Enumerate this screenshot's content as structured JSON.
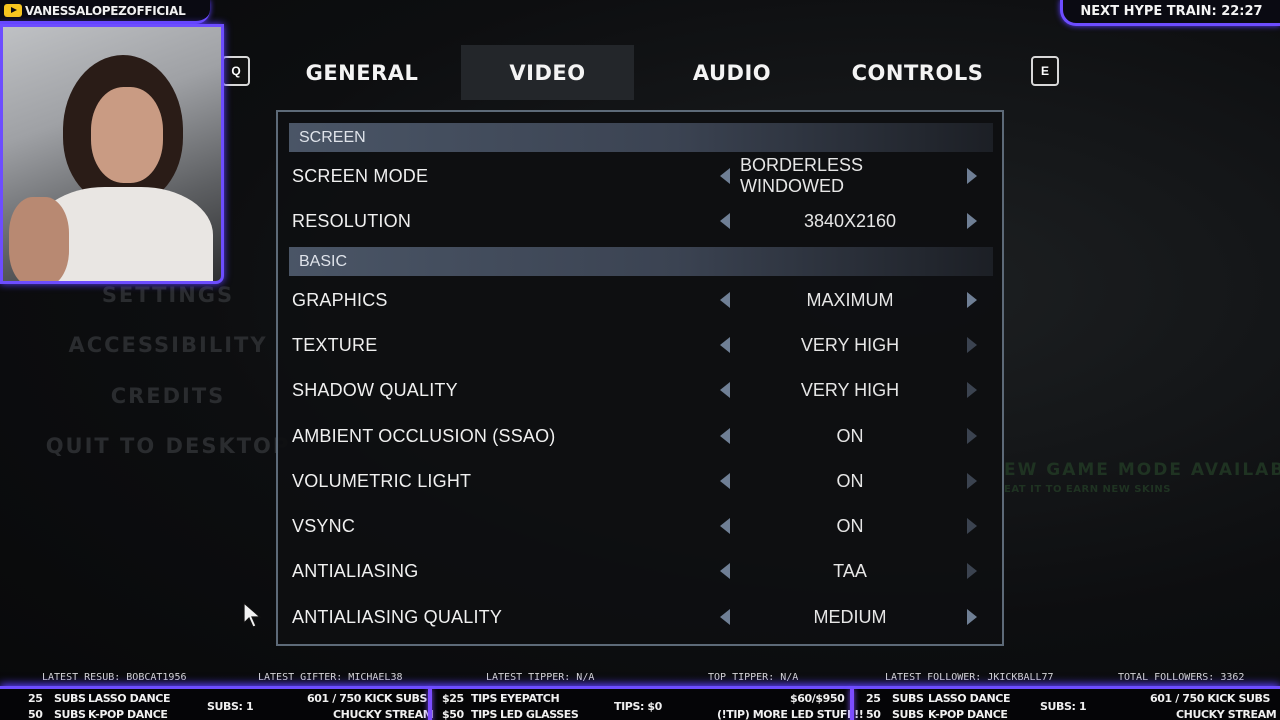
{
  "background": {
    "ghost_menu": [
      "SETTINGS",
      "ACCESSIBILITY",
      "CREDITS",
      "QUIT TO DESKTOP"
    ],
    "banner_title": "EW GAME MODE AVAILABLE!",
    "banner_sub": "EAT IT TO EARN NEW SKINS"
  },
  "tabs": {
    "prev_key": "Q",
    "next_key": "E",
    "items": [
      {
        "label": "GENERAL"
      },
      {
        "label": "VIDEO",
        "active": true
      },
      {
        "label": "AUDIO"
      },
      {
        "label": "CONTROLS"
      }
    ]
  },
  "settings": {
    "section_screen": "SCREEN",
    "section_basic": "BASIC",
    "rows": [
      {
        "label": "SCREEN MODE",
        "value": "BORDERLESS WINDOWED"
      },
      {
        "label": "RESOLUTION",
        "value": "3840X2160"
      },
      {
        "label": "GRAPHICS",
        "value": "MAXIMUM"
      },
      {
        "label": "TEXTURE",
        "value": "VERY HIGH"
      },
      {
        "label": "SHADOW QUALITY",
        "value": "VERY HIGH"
      },
      {
        "label": "AMBIENT OCCLUSION (SSAO)",
        "value": "ON"
      },
      {
        "label": "VOLUMETRIC LIGHT",
        "value": "ON"
      },
      {
        "label": "VSYNC",
        "value": "ON"
      },
      {
        "label": "ANTIALIASING",
        "value": "TAA"
      },
      {
        "label": "ANTIALIASING QUALITY",
        "value": "MEDIUM"
      }
    ]
  },
  "overlay": {
    "channel": "VANESSALOPEZOFFICIAL",
    "hype_train": "NEXT HYPE TRAIN: 22:27",
    "latest_resub": "LATEST RESUB: BOBCAT1956",
    "latest_gifter": "LATEST GIFTER: MICHAEL38",
    "latest_tipper": "LATEST TIPPER: N/A",
    "top_tipper": "TOP TIPPER: N/A",
    "latest_follower": "LATEST FOLLOWER: JKICKBALL77",
    "total_followers": "TOTAL FOLLOWERS: 3362",
    "goal1_a_num": "25",
    "goal1_a_unit": "SUBS",
    "goal1_a_text": "LASSO DANCE",
    "goal1_b_num": "50",
    "goal1_b_unit": "SUBS",
    "goal1_b_text": "K-POP DANCE",
    "subs_count": "SUBS: 1",
    "kick_subs": "601 / 750 KICK SUBS",
    "kick_goal": "CHUCKY STREAM",
    "tip_a_num": "$25",
    "tip_a_unit": "TIPS",
    "tip_a_text": "EYEPATCH",
    "tip_b_num": "$50",
    "tip_b_unit": "TIPS",
    "tip_b_text": "LED GLASSES",
    "tips_total": "TIPS: $0",
    "tip_goal_amount": "$60/$950",
    "tip_goal_text": "(!TIP) MORE LED STUFF!!",
    "goal2_a_num": "25",
    "goal2_a_unit": "SUBS",
    "goal2_a_text": "LASSO DANCE",
    "goal2_b_num": "50",
    "goal2_b_unit": "SUBS",
    "goal2_b_text": "K-POP DANCE",
    "subs_count2": "SUBS: 1",
    "kick_subs2": "601 / 750 KICK SUBS",
    "kick_goal2": "CHUCKY STREAM"
  },
  "colors": {
    "accent": "#6d4dff",
    "panel_border": "#5d6a78",
    "arrow": "#6f7f95"
  }
}
